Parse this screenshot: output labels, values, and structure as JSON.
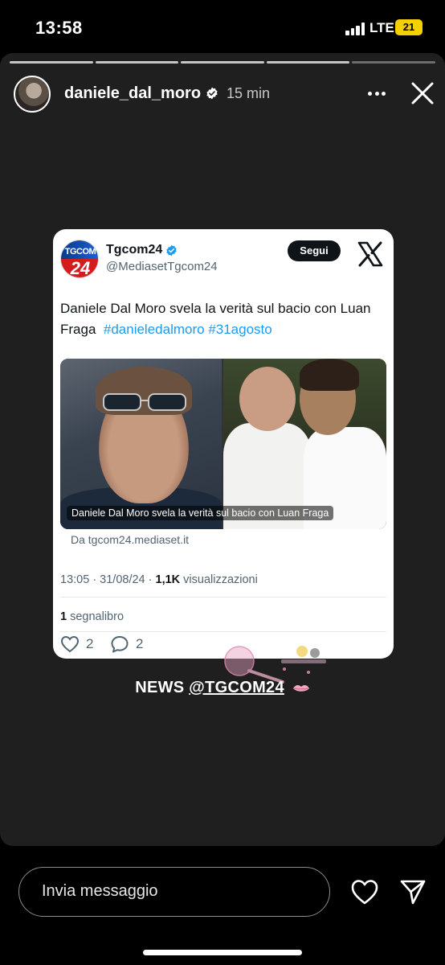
{
  "status_bar": {
    "time": "13:58",
    "network": "LTE",
    "battery": "21"
  },
  "story": {
    "username": "daniele_dal_moro",
    "time_ago": "15 min",
    "progress_segments_total": 5,
    "progress_current_segment": 5
  },
  "tweet": {
    "account_name": "Tgcom24",
    "handle": "@MediasetTgcom24",
    "follow_label": "Segui",
    "text_plain": "Daniele Dal Moro svela la verità sul bacio con Luan Fraga",
    "hashtag_1": "#danieledalmoro",
    "hashtag_2": "#31agosto",
    "logo_text_top": "TGCOM",
    "logo_text_bottom": "24",
    "media_caption": "Daniele Dal Moro svela la verità sul bacio con Luan Fraga",
    "source": "Da tgcom24.mediaset.it",
    "timestamp": "13:05 · 31/08/24 · ",
    "views_count": "1,1K",
    "views_label": " visualizzazioni",
    "bookmarks_count": "1",
    "bookmarks_label": " segnalibro",
    "likes": "2",
    "replies": "2"
  },
  "caption": {
    "prefix": "NEWS ",
    "mention": "@TGCOM24"
  },
  "bottom": {
    "message_placeholder": "Invia messaggio"
  },
  "colors": {
    "story_bg": "#1f1f1f",
    "link_blue": "#1d9bf0",
    "verified_blue": "#1d9bf0",
    "battery_yellow": "#f5d000"
  }
}
